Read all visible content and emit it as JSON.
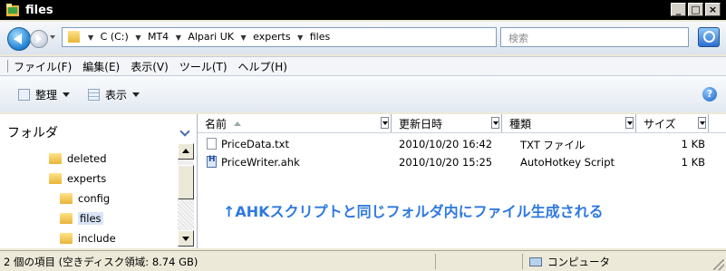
{
  "window": {
    "title": "files"
  },
  "address": {
    "crumbs": [
      "C (C:)",
      "MT4",
      "Alpari UK",
      "experts",
      "files"
    ],
    "search_placeholder": "検索"
  },
  "menu": {
    "items": [
      "ファイル(F)",
      "編集(E)",
      "表示(V)",
      "ツール(T)",
      "ヘルプ(H)"
    ]
  },
  "toolbar": {
    "organize_label": "整理",
    "view_label": "表示"
  },
  "nav_pane": {
    "header": "フォルダ",
    "items": [
      {
        "label": "deleted"
      },
      {
        "label": "experts"
      },
      {
        "label": "config"
      },
      {
        "label": "files"
      },
      {
        "label": "include"
      }
    ]
  },
  "list": {
    "columns": [
      "名前",
      "更新日時",
      "種類",
      "サイズ"
    ],
    "rows": [
      {
        "name": "PriceData.txt",
        "modified": "2010/10/20 16:42",
        "type": "TXT ファイル",
        "size": "1 KB"
      },
      {
        "name": "PriceWriter.ahk",
        "modified": "2010/10/20 15:25",
        "type": "AutoHotkey Script",
        "size": "1 KB"
      }
    ],
    "note": "↑AHKスクリプトと同じフォルダ内にファイル生成される"
  },
  "status": {
    "left": "2 個の項目 (空きディスク領域: 8.74 GB)",
    "right": "コンピュータ"
  },
  "colors": {
    "note": "#2f79df",
    "titlebar": "#000000"
  }
}
